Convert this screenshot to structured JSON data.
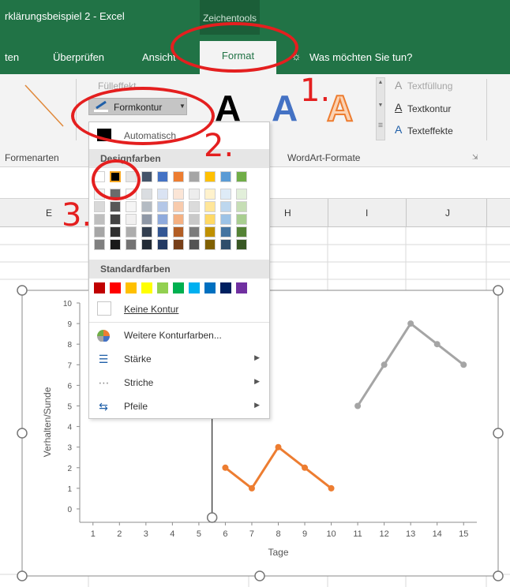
{
  "titlebar": {
    "title": "rklärungsbeispiel 2  -  Excel",
    "context_tab": "Zeichentools"
  },
  "tabs": {
    "items": [
      "ten",
      "Überprüfen",
      "Ansicht",
      "Format"
    ],
    "tell_me": "Was möchten Sie tun?"
  },
  "ribbon": {
    "fuelleffekt": "Fülleffekt",
    "formkontur": "Formkontur",
    "textfuellung": "Textfüllung",
    "textkontur": "Textkontur",
    "texteffekte": "Texteffekte",
    "wordart_letter": "A",
    "groups": {
      "formenarten": "Formenarten",
      "wordart": "WordArt-Formate"
    }
  },
  "columns": [
    "E",
    "H",
    "I",
    "J"
  ],
  "dropdown": {
    "automatic": "Automatisch",
    "theme_header": "Designfarben",
    "standard_header": "Standardfarben",
    "no_outline": "Keine Kontur",
    "more_colors": "Weitere Konturfarben...",
    "weight": "Stärke",
    "dashes": "Striche",
    "arrows": "Pfeile",
    "theme_top_row": [
      "#ffffff",
      "#000000",
      "#e7e6e6",
      "#44546a",
      "#4472c4",
      "#ed7d31",
      "#a5a5a5",
      "#ffc000",
      "#5b9bd5",
      "#70ad47"
    ],
    "standard_colors": [
      "#c00000",
      "#ff0000",
      "#ffc000",
      "#ffff00",
      "#92d050",
      "#00b050",
      "#00b0f0",
      "#0070c0",
      "#002060",
      "#7030a0"
    ]
  },
  "annotations": [
    "1.",
    "2.",
    "3."
  ],
  "chart_data": {
    "type": "line",
    "ylabel": "Verhalten/Sunde",
    "xlabel": "Tage",
    "ylim": [
      0,
      10
    ],
    "x_ticks": [
      "1",
      "2",
      "3",
      "4",
      "5",
      "6",
      "7",
      "8",
      "9",
      "10",
      "11",
      "12",
      "13",
      "14",
      "15"
    ],
    "y_ticks": [
      "0",
      "1",
      "2",
      "3",
      "4",
      "5",
      "6",
      "7",
      "8",
      "9",
      "10"
    ],
    "series": [
      {
        "color": "#ed7d31",
        "x": [
          6,
          7,
          8,
          9,
          10
        ],
        "y": [
          2,
          1,
          3,
          2,
          1
        ]
      },
      {
        "color": "#a5a5a5",
        "x": [
          11,
          12,
          13,
          14,
          15
        ],
        "y": [
          5,
          7,
          9,
          8,
          7
        ]
      }
    ],
    "phase_line_x": 5.5
  }
}
